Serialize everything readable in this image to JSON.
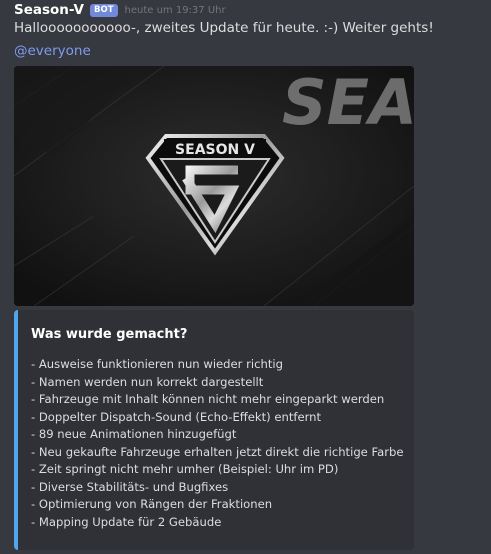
{
  "message": {
    "author": "Season-V",
    "bot_tag": "BOT",
    "timestamp": "heute um 19:37 Uhr",
    "text": "Hallooooooooooo-, zweites Update für heute. :-) Weiter gehts!",
    "mention": "@everyone"
  },
  "banner": {
    "logo_text": "SEASON V",
    "background_text": "SEAS"
  },
  "embed": {
    "accent_color": "#4fa7f0",
    "title": "Was wurde gemacht?",
    "items": [
      "- Ausweise funktionieren nun wieder richtig",
      "- Namen werden nun korrekt dargestellt",
      "- Fahrzeuge mit Inhalt können nicht mehr eingeparkt werden",
      "- Doppelter Dispatch-Sound (Echo-Effekt) entfernt",
      "- 89 neue Animationen hinzugefügt",
      "- Neu gekaufte Fahrzeuge erhalten jetzt direkt die richtige Farbe",
      "- Zeit springt nicht mehr umher (Beispiel: Uhr im PD)",
      "- Diverse Stabilitäts- und Bugfixes",
      "- Optimierung von Rängen der Fraktionen",
      "- Mapping Update für 2 Gebäude"
    ]
  },
  "colors": {
    "background": "#36393f",
    "embed_background": "#2f3136",
    "bot_tag": "#7289da",
    "mention": "#7f9af0"
  }
}
